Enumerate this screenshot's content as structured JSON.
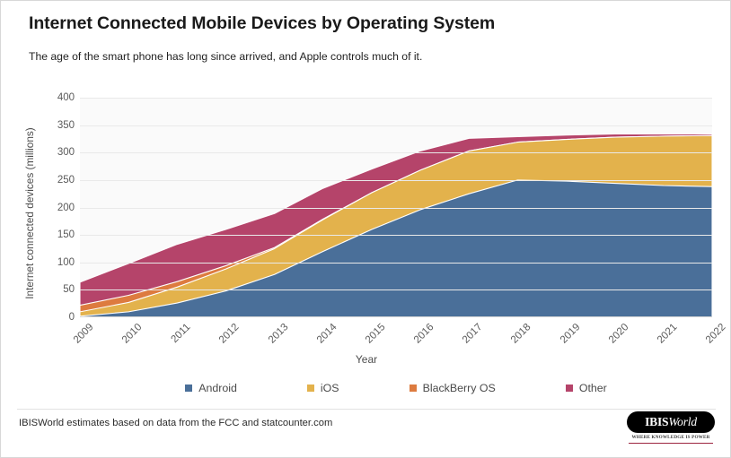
{
  "header": {
    "title": "Internet Connected Mobile Devices by Operating System",
    "subtitle": "The age of the smart phone has long since arrived, and Apple controls much of it."
  },
  "footer": {
    "note": "IBISWorld estimates based on data from the FCC and statcounter.com",
    "brand_name_bold": "IBIS",
    "brand_name_italic": "World",
    "brand_tagline": "Where knowledge is power"
  },
  "colors": {
    "android": "#4a6f99",
    "ios": "#e3b24c",
    "blackberry": "#dd7b3f",
    "other": "#b5446a",
    "plot_background": "#fafafa",
    "gridline": "#e9e9e9",
    "axis_text": "#5a5a5a"
  },
  "chart_data": {
    "type": "area",
    "stacked": true,
    "title": "Internet Connected Mobile Devices by Operating System",
    "subtitle": "The age of the smart phone has long since arrived, and Apple controls much of it.",
    "xlabel": "Year",
    "ylabel": "Internet connected devices (millions)",
    "categories": [
      "2009",
      "2010",
      "2011",
      "2012",
      "2013",
      "2014",
      "2015",
      "2016",
      "2017",
      "2018",
      "2019",
      "2020",
      "2021",
      "2022"
    ],
    "ylim": [
      0,
      400
    ],
    "yticks": [
      0,
      50,
      100,
      150,
      200,
      250,
      300,
      350,
      400
    ],
    "grid": true,
    "legend_position": "bottom",
    "series": [
      {
        "name": "Android",
        "color": "#4a6f99",
        "values": [
          2,
          10,
          26,
          48,
          78,
          120,
          160,
          196,
          225,
          250,
          248,
          244,
          240,
          238
        ]
      },
      {
        "name": "iOS",
        "color": "#e3b24c",
        "values": [
          8,
          17,
          29,
          40,
          47,
          58,
          67,
          72,
          78,
          69,
          76,
          84,
          90,
          93
        ]
      },
      {
        "name": "BlackBerry OS",
        "color": "#dd7b3f",
        "values": [
          12,
          13,
          10,
          6,
          2,
          1,
          0,
          0,
          0,
          0,
          0,
          0,
          0,
          0
        ]
      },
      {
        "name": "Other",
        "color": "#b5446a",
        "values": [
          42,
          58,
          68,
          66,
          62,
          56,
          43,
          35,
          23,
          10,
          8,
          6,
          4,
          3
        ]
      }
    ],
    "totals": [
      64,
      98,
      133,
      160,
      189,
      235,
      270,
      303,
      326,
      329,
      332,
      334,
      334,
      334
    ]
  },
  "legend": {
    "items": [
      {
        "label": "Android",
        "color": "#4a6f99"
      },
      {
        "label": "iOS",
        "color": "#e3b24c"
      },
      {
        "label": "BlackBerry OS",
        "color": "#dd7b3f"
      },
      {
        "label": "Other",
        "color": "#b5446a"
      }
    ]
  }
}
